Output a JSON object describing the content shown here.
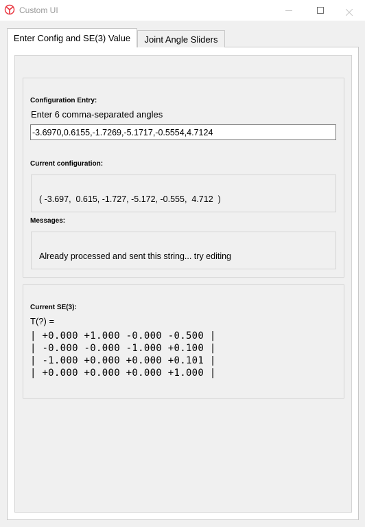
{
  "window": {
    "title": "Custom UI"
  },
  "tabs": [
    {
      "label": "Enter Config and SE(3) Value",
      "active": true
    },
    {
      "label": "Joint Angle Sliders",
      "active": false
    }
  ],
  "config_entry": {
    "section_label": "Configuration Entry:",
    "prompt": "Enter 6 comma-separated angles",
    "value": "-3.6970,0.6155,-1.7269,-5.1717,-0.5554,4.7124"
  },
  "current_configuration": {
    "section_label": "Current configuration:",
    "value": "( -3.697,  0.615, -1.727, -5.172, -0.555,  4.712  )"
  },
  "messages": {
    "section_label": "Messages:",
    "value": "Already processed and sent this string... try editing"
  },
  "se3": {
    "section_label": "Current SE(3):",
    "heading": "T(?) =",
    "rows": [
      "| +0.000 +1.000 -0.000 -0.500 |",
      "| -0.000 -0.000 -1.000 +0.100 |",
      "| -1.000 +0.000 +0.000 +0.101 |",
      "| +0.000 +0.000 +0.000 +1.000 |"
    ]
  },
  "colors": {
    "app_icon": "#e8323c",
    "window_bg": "#f0f0f0",
    "title_text": "#9a9a9a"
  },
  "icons": {
    "app": "app-logo-icon",
    "minimize": "minimize-icon",
    "maximize": "maximize-icon",
    "close": "close-icon"
  }
}
